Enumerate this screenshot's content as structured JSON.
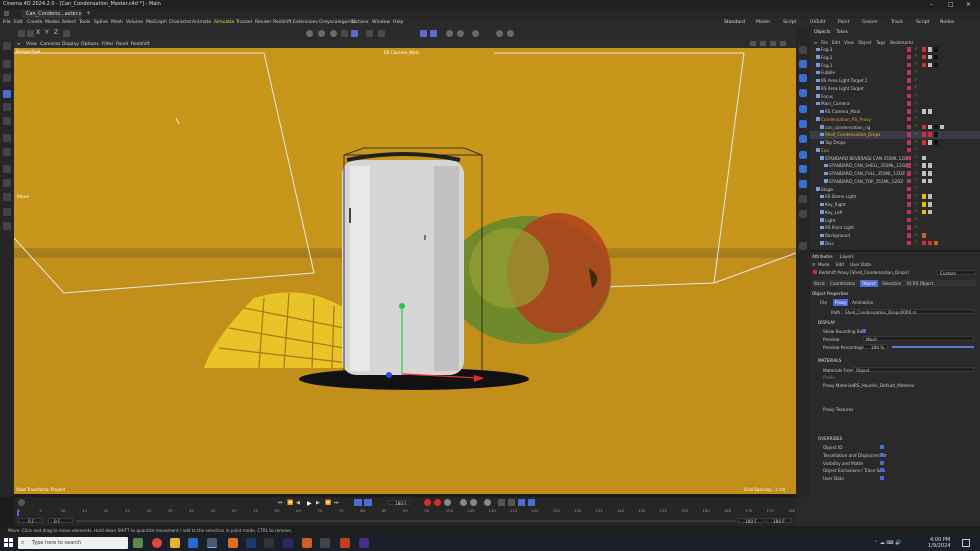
{
  "window": {
    "title": "Cinema 4D 2024.2.0 - [Can_Condensation_Master.c4d *] - Main",
    "controls": [
      "–",
      "□",
      "✕"
    ]
  },
  "doc_tab": {
    "label": "Can_Condens...aster.c4d *"
  },
  "menu": {
    "items": [
      "File",
      "Edit",
      "Create",
      "Modes",
      "Select",
      "Tools",
      "Spline",
      "Mesh",
      "Volume",
      "MoGraph",
      "Character",
      "Animate",
      "Simulate",
      "Tracker",
      "Render",
      "Redshift",
      "Extensions",
      "Greyscalegorilla",
      "Octane",
      "Window",
      "Help"
    ],
    "layouts": [
      "Standard",
      "Model",
      "Script",
      "UVEdit",
      "Paint",
      "Groom",
      "Track",
      "Script",
      "Nodes"
    ],
    "active_layout": "Standard"
  },
  "viewport_menu": {
    "items": [
      "View",
      "Cameras",
      "Display",
      "Options",
      "Filter",
      "Panel",
      "Redshift"
    ]
  },
  "viewport": {
    "label": "Perspective",
    "camera": "RS Camera_Main",
    "move_label": "Move",
    "hud_bottom_left": "View Transform: Project",
    "hud_bottom_right": "Grid Spacing : 1 cm",
    "bg_color": "#c8961a"
  },
  "timeline": {
    "ticks": [
      "0",
      "5",
      "10",
      "15",
      "20",
      "25",
      "30",
      "35",
      "40",
      "45",
      "50",
      "55",
      "60",
      "65",
      "70",
      "75",
      "80",
      "85",
      "90",
      "95",
      "100",
      "105",
      "110",
      "115",
      "120",
      "125",
      "130",
      "135",
      "140",
      "145",
      "150",
      "155",
      "160",
      "165",
      "170",
      "175",
      "180"
    ],
    "start_frame": "0 F",
    "start_frame2": "0 F",
    "current_frame": "180 F",
    "end_frame": "180 F",
    "end_frame2": "180 F"
  },
  "status": {
    "text": "Move: Click and drag to move elements. Hold down SHIFT to quantize movement / add to the selection in point mode, CTRL to remove."
  },
  "objects_panel": {
    "tabs": [
      "Objects",
      "Takes"
    ],
    "menu": [
      "File",
      "Edit",
      "View",
      "Object",
      "Tags",
      "Bookmarks"
    ],
    "rows": [
      {
        "name": "Fog.3",
        "indent": 1,
        "color": "#c8c8c8",
        "tags": [
          "#d23030",
          "#c0c0c0",
          "#111"
        ]
      },
      {
        "name": "Fog.2",
        "indent": 1,
        "color": "#c8c8c8",
        "tags": [
          "#d23030",
          "#c0c0c0",
          "#111"
        ]
      },
      {
        "name": "Fog.1",
        "indent": 1,
        "color": "#c8c8c8",
        "tags": [
          "#d23030",
          "#c0c0c0",
          "#111"
        ]
      },
      {
        "name": "Fubble",
        "indent": 1,
        "color": "#c8c8c8",
        "tags": []
      },
      {
        "name": "RS Area Light.Target.1",
        "indent": 1,
        "color": "#c8c8c8",
        "tags": []
      },
      {
        "name": "RS Area Light.Target",
        "indent": 1,
        "color": "#c8c8c8",
        "tags": []
      },
      {
        "name": "Focus",
        "indent": 1,
        "color": "#c8c8c8",
        "tags": []
      },
      {
        "name": "Main_Camera",
        "indent": 1,
        "color": "#c8c8c8",
        "tags": []
      },
      {
        "name": "RS Camera_Main",
        "indent": 2,
        "color": "#c8c8c8",
        "tags": [
          "#c0c0c0",
          "#c0c0c0"
        ]
      },
      {
        "name": "Condensation_RS_Proxy",
        "indent": 1,
        "color": "#e0a040",
        "tags": []
      },
      {
        "name": "can_condensation_rig",
        "indent": 2,
        "color": "#c8c8c8",
        "tags": [
          "#d23030",
          "#c0c0c0",
          "#111",
          "#c0c0c0"
        ]
      },
      {
        "name": "Shell_Condensation_Drops",
        "indent": 2,
        "color": "#e8c000",
        "tags": [
          "#d23030",
          "#d23030",
          "#111"
        ]
      },
      {
        "name": "Top Drops",
        "indent": 2,
        "color": "#c8c8c8",
        "tags": [
          "#d23030",
          "#c0c0c0",
          "#111"
        ]
      },
      {
        "name": "Can",
        "indent": 1,
        "color": "#e0a040",
        "tags": []
      },
      {
        "name": "STANDARD BEVERAGE CAN 355ML 12OZ",
        "indent": 2,
        "color": "#c8c8c8",
        "tags": [
          "#c0c0c0"
        ]
      },
      {
        "name": "STANDARD_CAN_SHELL_355ML_12OZ",
        "indent": 3,
        "color": "#c8c8c8",
        "tags": [
          "#c0c0c0",
          "#c0c0c0"
        ]
      },
      {
        "name": "STANDARD_CAN_FULL_355ML_12OZ",
        "indent": 3,
        "color": "#c8c8c8",
        "tags": [
          "#c0c0c0",
          "#c0c0c0"
        ]
      },
      {
        "name": "STANDARD_CAN_TOP_355ML_12OZ",
        "indent": 3,
        "color": "#c8c8c8",
        "tags": [
          "#c0c0c0",
          "#c0c0c0"
        ]
      },
      {
        "name": "Stage",
        "indent": 1,
        "color": "#c8c8c8",
        "tags": []
      },
      {
        "name": "RS Dome Light",
        "indent": 2,
        "color": "#c8c8c8",
        "tags": [
          "#e8c000",
          "#c0c0c0"
        ]
      },
      {
        "name": "Key_Right",
        "indent": 2,
        "color": "#c8c8c8",
        "tags": [
          "#e8c000",
          "#c0c0c0"
        ]
      },
      {
        "name": "Key_Left",
        "indent": 2,
        "color": "#c8c8c8",
        "tags": [
          "#e8c000",
          "#c0c0c0"
        ]
      },
      {
        "name": "Light",
        "indent": 2,
        "color": "#c8c8c8",
        "tags": []
      },
      {
        "name": "RS Point Light",
        "indent": 2,
        "color": "#c8c8c8",
        "tags": []
      },
      {
        "name": "Background",
        "indent": 2,
        "color": "#c8c8c8",
        "tags": [
          "#d06020"
        ]
      },
      {
        "name": "Disc",
        "indent": 2,
        "color": "#c8c8c8",
        "tags": [
          "#d23030",
          "#d23030",
          "#d06020"
        ]
      }
    ]
  },
  "attributes_panel": {
    "tabs": [
      "Attributes",
      "Layers"
    ],
    "menu": [
      "Mode",
      "Edit",
      "User Data"
    ],
    "object_title": "Redshift Proxy [Shell_Condensation_Drops]",
    "preset": "Custom",
    "sub_tabs": [
      "Basic",
      "Coordinates",
      "Object",
      "Selection",
      "ID RS Object"
    ],
    "active_sub_tab": "Object",
    "section_title": "Object Properties",
    "file_tabs": [
      "File",
      "Proxy",
      "Animation"
    ],
    "active_file_tab": "Proxy",
    "path_label": "Path",
    "path_value": "Shell_Condensation_Drops0000.rs",
    "display_header": "DISPLAY",
    "show_bbox_label": "Show Bounding Box",
    "preview_label": "Preview",
    "preview_value": "Mesh",
    "preview_pct_label": "Preview Percentage",
    "preview_pct_value": "100 %",
    "materials_header": "MATERIALS",
    "materials_from_label": "Materials From",
    "materials_from_value": "Object",
    "prefix_label": "Prefix",
    "proxy_materials_label": "Proxy Materials",
    "proxy_materials_value": "RS_Houdini_Default_Material",
    "proxy_textures_label": "Proxy Textures",
    "overrides_header": "OVERRIDES",
    "override_items": [
      "Object ID",
      "Tessellation and Displacement",
      "Visibility and Matte",
      "Object Exclusions / Trace Sets",
      "User Data"
    ]
  },
  "taskbar": {
    "search_placeholder": "Type here to search",
    "time": "4:00 PM",
    "date": "1/9/2024"
  },
  "colors": {
    "accent": "#4d6bd6",
    "viewport_bg": "#c8961a"
  }
}
